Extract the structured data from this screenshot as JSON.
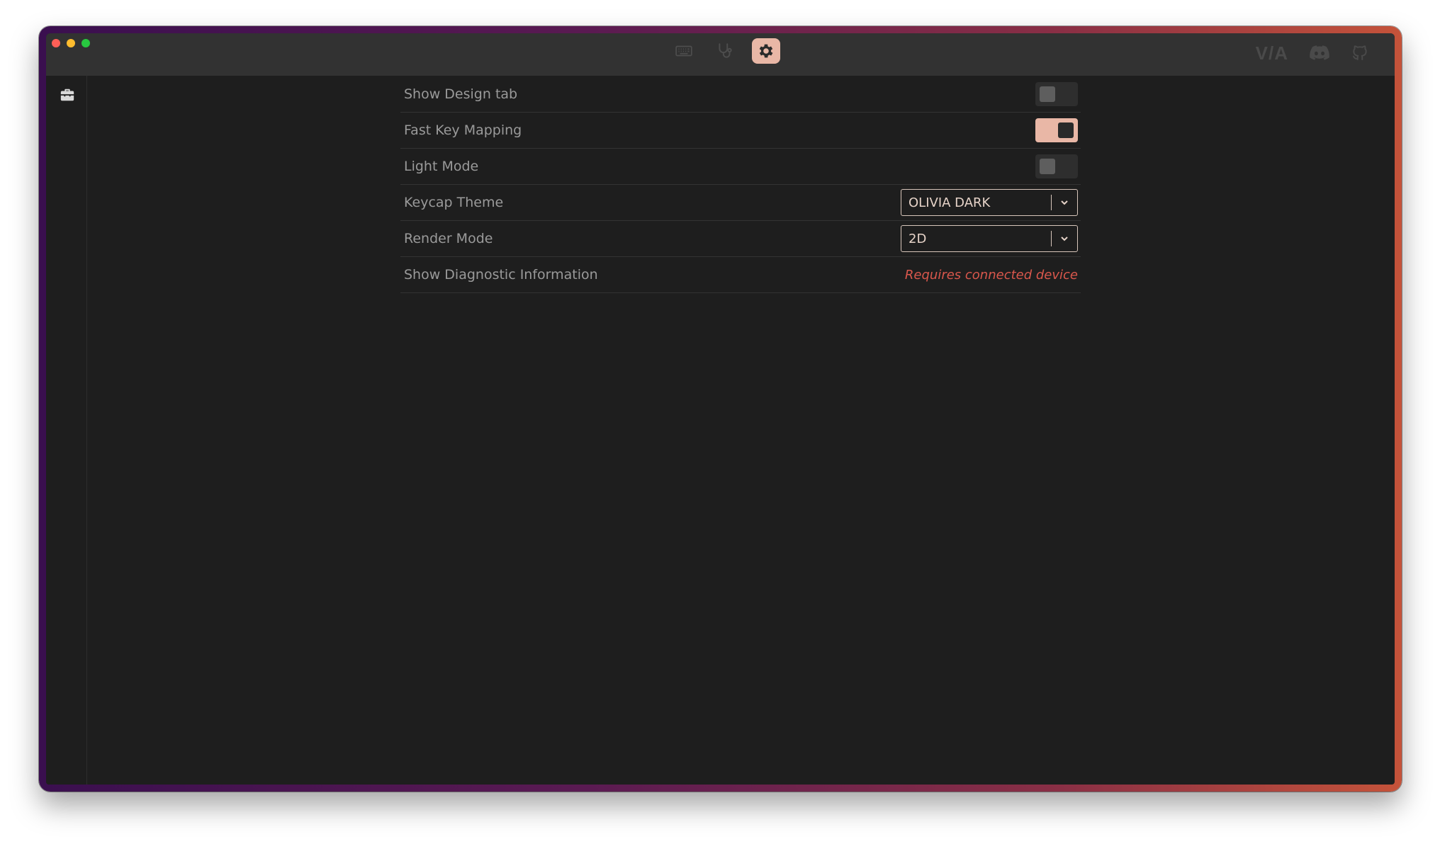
{
  "window": {
    "traffic_lights": [
      "close",
      "minimize",
      "zoom"
    ]
  },
  "titlebar": {
    "tabs": [
      {
        "icon": "keyboard-icon",
        "active": false
      },
      {
        "icon": "stethoscope-icon",
        "active": false
      },
      {
        "icon": "gear-icon",
        "active": true
      }
    ],
    "right_icons": {
      "logo_text": "V/A",
      "discord": "discord-icon",
      "github": "github-icon"
    }
  },
  "sidebar": {
    "items": [
      {
        "icon": "toolbox-icon"
      }
    ]
  },
  "settings": {
    "rows": [
      {
        "label": "Show Design tab",
        "control": "toggle",
        "value": false
      },
      {
        "label": "Fast Key Mapping",
        "control": "toggle",
        "value": true
      },
      {
        "label": "Light Mode",
        "control": "toggle",
        "value": false
      },
      {
        "label": "Keycap Theme",
        "control": "select",
        "value": "OLIVIA DARK"
      },
      {
        "label": "Render Mode",
        "control": "select",
        "value": "2D"
      },
      {
        "label": "Show Diagnostic Information",
        "control": "message",
        "value": "Requires connected device"
      }
    ]
  },
  "colors": {
    "accent": "#e9b7a6",
    "background": "#1e1e1e",
    "titlebar": "#323232",
    "warning": "#d9574c"
  }
}
